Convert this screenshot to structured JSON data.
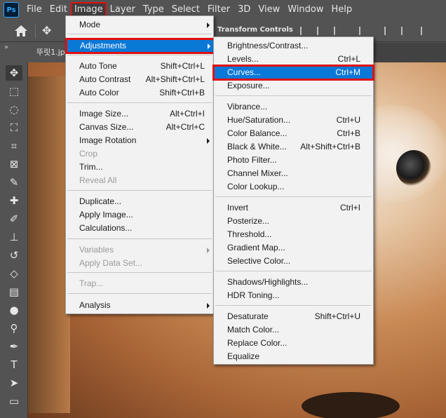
{
  "app": {
    "logo": "Ps"
  },
  "menubar": {
    "items": [
      "File",
      "Edit",
      "Image",
      "Layer",
      "Type",
      "Select",
      "Filter",
      "3D",
      "View",
      "Window",
      "Help"
    ],
    "active": "Image"
  },
  "options_bar": {
    "transform_controls_label": "Transform Controls"
  },
  "document": {
    "tab_label": "뚜릿1.jpg"
  },
  "image_menu": {
    "items": [
      {
        "label": "Mode",
        "shortcut": "",
        "submenu": true,
        "disabled": false
      },
      {
        "label": "Adjustments",
        "shortcut": "",
        "submenu": true,
        "disabled": false
      },
      {
        "label": "Auto Tone",
        "shortcut": "Shift+Ctrl+L",
        "submenu": false,
        "disabled": false
      },
      {
        "label": "Auto Contrast",
        "shortcut": "Alt+Shift+Ctrl+L",
        "submenu": false,
        "disabled": false
      },
      {
        "label": "Auto Color",
        "shortcut": "Shift+Ctrl+B",
        "submenu": false,
        "disabled": false
      },
      {
        "label": "Image Size...",
        "shortcut": "Alt+Ctrl+I",
        "submenu": false,
        "disabled": false
      },
      {
        "label": "Canvas Size...",
        "shortcut": "Alt+Ctrl+C",
        "submenu": false,
        "disabled": false
      },
      {
        "label": "Image Rotation",
        "shortcut": "",
        "submenu": true,
        "disabled": false
      },
      {
        "label": "Crop",
        "shortcut": "",
        "submenu": false,
        "disabled": true
      },
      {
        "label": "Trim...",
        "shortcut": "",
        "submenu": false,
        "disabled": false
      },
      {
        "label": "Reveal All",
        "shortcut": "",
        "submenu": false,
        "disabled": true
      },
      {
        "label": "Duplicate...",
        "shortcut": "",
        "submenu": false,
        "disabled": false
      },
      {
        "label": "Apply Image...",
        "shortcut": "",
        "submenu": false,
        "disabled": false
      },
      {
        "label": "Calculations...",
        "shortcut": "",
        "submenu": false,
        "disabled": false
      },
      {
        "label": "Variables",
        "shortcut": "",
        "submenu": true,
        "disabled": true
      },
      {
        "label": "Apply Data Set...",
        "shortcut": "",
        "submenu": false,
        "disabled": true
      },
      {
        "label": "Trap...",
        "shortcut": "",
        "submenu": false,
        "disabled": true
      },
      {
        "label": "Analysis",
        "shortcut": "",
        "submenu": true,
        "disabled": false
      }
    ]
  },
  "adjustments_menu": {
    "items": [
      {
        "label": "Brightness/Contrast...",
        "shortcut": ""
      },
      {
        "label": "Levels...",
        "shortcut": "Ctrl+L"
      },
      {
        "label": "Curves...",
        "shortcut": "Ctrl+M"
      },
      {
        "label": "Exposure...",
        "shortcut": ""
      },
      {
        "label": "Vibrance...",
        "shortcut": ""
      },
      {
        "label": "Hue/Saturation...",
        "shortcut": "Ctrl+U"
      },
      {
        "label": "Color Balance...",
        "shortcut": "Ctrl+B"
      },
      {
        "label": "Black & White...",
        "shortcut": "Alt+Shift+Ctrl+B"
      },
      {
        "label": "Photo Filter...",
        "shortcut": ""
      },
      {
        "label": "Channel Mixer...",
        "shortcut": ""
      },
      {
        "label": "Color Lookup...",
        "shortcut": ""
      },
      {
        "label": "Invert",
        "shortcut": "Ctrl+I"
      },
      {
        "label": "Posterize...",
        "shortcut": ""
      },
      {
        "label": "Threshold...",
        "shortcut": ""
      },
      {
        "label": "Gradient Map...",
        "shortcut": ""
      },
      {
        "label": "Selective Color...",
        "shortcut": ""
      },
      {
        "label": "Shadows/Highlights...",
        "shortcut": ""
      },
      {
        "label": "HDR Toning...",
        "shortcut": ""
      },
      {
        "label": "Desaturate",
        "shortcut": "Shift+Ctrl+U"
      },
      {
        "label": "Match Color...",
        "shortcut": ""
      },
      {
        "label": "Replace Color...",
        "shortcut": ""
      },
      {
        "label": "Equalize",
        "shortcut": ""
      }
    ]
  },
  "colors": {
    "highlight": "#0a78d7",
    "callout": "#e01010",
    "ui_dark": "#535353"
  },
  "toolbar": {
    "tools": [
      "move-icon",
      "marquee-icon",
      "lasso-icon",
      "quick-select-icon",
      "crop-icon",
      "frame-icon",
      "eyedropper-icon",
      "healing-icon",
      "brush-icon",
      "stamp-icon",
      "history-brush-icon",
      "eraser-icon",
      "gradient-icon",
      "blur-icon",
      "dodge-icon",
      "pen-icon",
      "type-icon",
      "path-select-icon",
      "rectangle-icon",
      "hand-icon"
    ]
  }
}
